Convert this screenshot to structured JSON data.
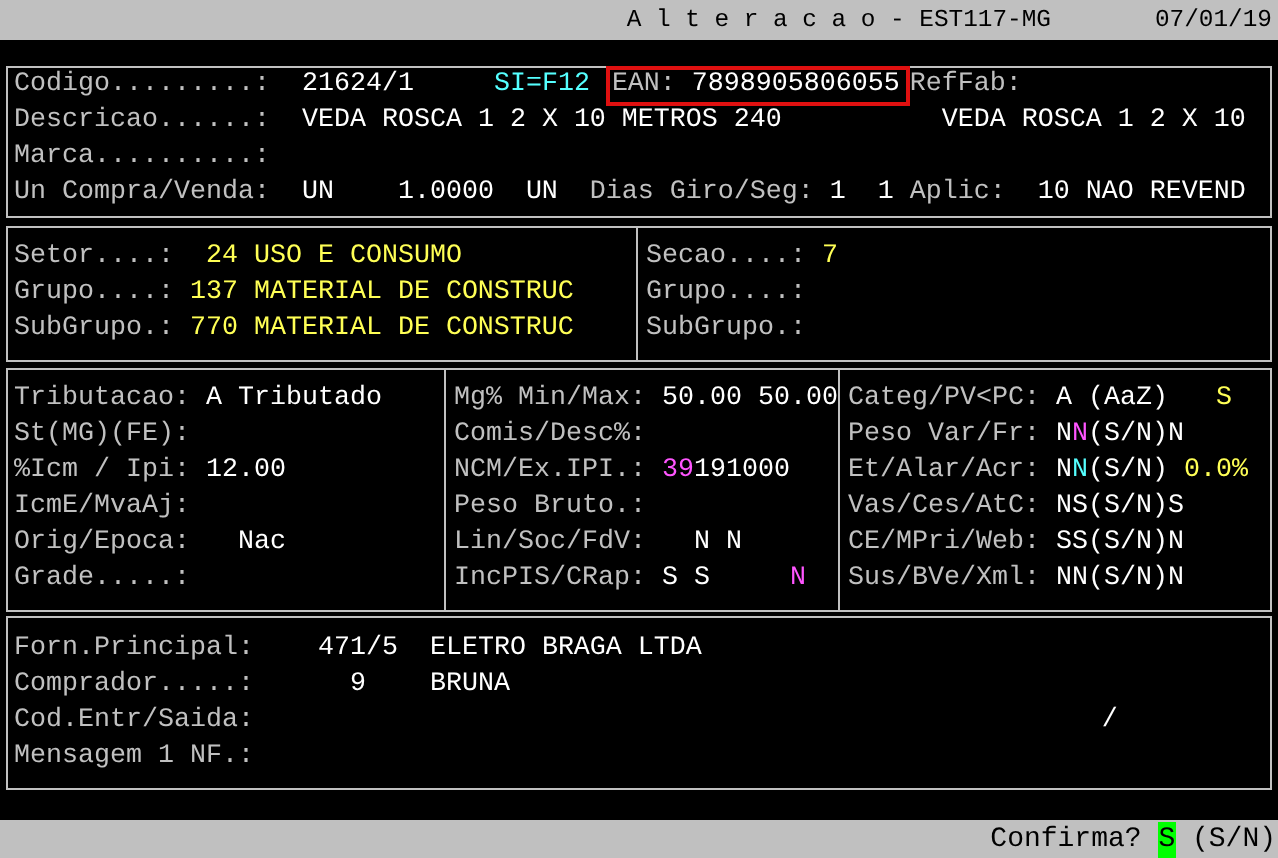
{
  "title_bar": {
    "title": "A l t e r a c a o - EST117-MG",
    "date": "07/01/19"
  },
  "panels": [
    {
      "columns": [
        {
          "fields": [
            {
              "label": "Codigo.........:",
              "items": [
                {
                  "text": "21624/1",
                  "kind": "value"
                },
                {
                  "text": "SI=F12",
                  "kind": "cyan"
                },
                {
                  "kind": "frame",
                  "parts": [
                    {
                      "text": "EAN:",
                      "kind": "label"
                    },
                    {
                      "text": "7898905806055",
                      "kind": "value"
                    }
                  ]
                },
                {
                  "text": "RefFab:",
                  "kind": "label"
                }
              ]
            },
            {
              "label": "Descricao......:",
              "items": [
                {
                  "text": "VEDA ROSCA 1 2 X 10 METROS 240",
                  "kind": "value"
                },
                {
                  "text": "VEDA ROSCA 1 2 X 10",
                  "kind": "value"
                }
              ]
            },
            {
              "label": "Marca..........:"
            },
            {
              "label": "Un Compra/Venda:",
              "items": [
                {
                  "text": "UN",
                  "kind": "value"
                },
                {
                  "text": "1.0000",
                  "kind": "value"
                },
                {
                  "text": "UN",
                  "kind": "value"
                },
                {
                  "text": "Dias Giro/Seg:",
                  "kind": "label"
                },
                {
                  "text": "1",
                  "kind": "value"
                },
                {
                  "text": "1",
                  "kind": "value"
                },
                {
                  "text": "Aplic:",
                  "kind": "label"
                },
                {
                  "text": "10 NAO REVEND",
                  "kind": "value"
                }
              ]
            }
          ]
        }
      ]
    },
    {
      "columns": [
        {
          "fields": [
            {
              "label": "Setor....:",
              "items": [
                {
                  "text": "24 USO E CONSUMO",
                  "kind": "yellow"
                }
              ]
            },
            {
              "label": "Grupo....:",
              "items": [
                {
                  "text": "137 MATERIAL DE CONSTRUC",
                  "kind": "yellow"
                }
              ]
            },
            {
              "label": "SubGrupo.:",
              "items": [
                {
                  "text": "770 MATERIAL DE CONSTRUC",
                  "kind": "yellow"
                }
              ]
            }
          ]
        },
        {
          "fields": [
            {
              "label": "Secao....:",
              "items": [
                {
                  "text": "7",
                  "kind": "yellow"
                }
              ]
            },
            {
              "label": "Grupo....:"
            },
            {
              "label": "SubGrupo.:"
            }
          ]
        }
      ]
    },
    {
      "columns": [
        {
          "fields": [
            {
              "label": "Tributacao:",
              "items": [
                {
                  "text": "A Tributado",
                  "kind": "value"
                }
              ]
            },
            {
              "label": "St(MG)(FE):"
            },
            {
              "label": "%Icm / Ipi:",
              "items": [
                {
                  "text": "12.00",
                  "kind": "value"
                }
              ]
            },
            {
              "label": "IcmE/MvaAj:"
            },
            {
              "label": "Orig/Epoca:",
              "items": [
                {
                  "text": "Nac",
                  "kind": "value"
                }
              ]
            },
            {
              "label": "Grade.....:"
            }
          ]
        },
        {
          "fields": [
            {
              "label": "Mg% Min/Max:",
              "items": [
                {
                  "text": "50.00",
                  "kind": "value"
                },
                {
                  "text": "50.00",
                  "kind": "value"
                }
              ]
            },
            {
              "label": "Comis/Desc%:"
            },
            {
              "label": "NCM/Ex.IPI.:",
              "items": [
                {
                  "text": "39",
                  "kind": "magenta"
                },
                {
                  "text": "191000",
                  "kind": "value"
                }
              ]
            },
            {
              "label": "Peso Bruto.:"
            },
            {
              "label": "Lin/Soc/FdV:",
              "items": [
                {
                  "text": "N",
                  "kind": "value"
                },
                {
                  "text": "N",
                  "kind": "value"
                }
              ]
            },
            {
              "label": "IncPIS/CRap:",
              "items": [
                {
                  "text": "S",
                  "kind": "value"
                },
                {
                  "text": "S",
                  "kind": "value"
                },
                {
                  "text": "N",
                  "kind": "magenta"
                }
              ]
            }
          ]
        },
        {
          "fields": [
            {
              "label": "Categ/PV<PC:",
              "items": [
                {
                  "text": "A (AaZ)",
                  "kind": "value"
                },
                {
                  "text": "S",
                  "kind": "yellow"
                }
              ]
            },
            {
              "label": "Peso Var/Fr:",
              "items": [
                {
                  "text": "N",
                  "kind": "value"
                },
                {
                  "text": "N",
                  "kind": "magenta"
                },
                {
                  "text": "(S/N)N",
                  "kind": "value"
                }
              ]
            },
            {
              "label": "Et/Alar/Acr:",
              "items": [
                {
                  "text": "N",
                  "kind": "value"
                },
                {
                  "text": "N",
                  "kind": "cyan"
                },
                {
                  "text": "(S/N)",
                  "kind": "value"
                },
                {
                  "text": "0.0%",
                  "kind": "yellow"
                }
              ]
            },
            {
              "label": "Vas/Ces/AtC:",
              "items": [
                {
                  "text": "NS(S/N)S",
                  "kind": "value"
                }
              ]
            },
            {
              "label": "CE/MPri/Web:",
              "items": [
                {
                  "text": "SS(S/N)N",
                  "kind": "value"
                }
              ]
            },
            {
              "label": "Sus/BVe/Xml:",
              "items": [
                {
                  "text": "NN(S/N)N",
                  "kind": "value"
                }
              ]
            }
          ]
        }
      ]
    },
    {
      "columns": [
        {
          "fields": [
            {
              "label": "Forn.Principal:",
              "items": [
                {
                  "text": "471/5",
                  "kind": "value"
                },
                {
                  "text": "ELETRO BRAGA LTDA",
                  "kind": "value"
                }
              ]
            },
            {
              "label": "Comprador.....:",
              "items": [
                {
                  "text": "9",
                  "kind": "value"
                },
                {
                  "text": "BRUNA",
                  "kind": "value"
                }
              ]
            },
            {
              "label": "Cod.Entr/Saida:",
              "items": [
                {
                  "text": "/",
                  "kind": "value"
                }
              ]
            },
            {
              "label": "Mensagem 1 NF.:"
            }
          ]
        }
      ]
    }
  ],
  "status_bar": {
    "prompt": "Confirma?",
    "answer": "S",
    "options": "(S/N)"
  }
}
